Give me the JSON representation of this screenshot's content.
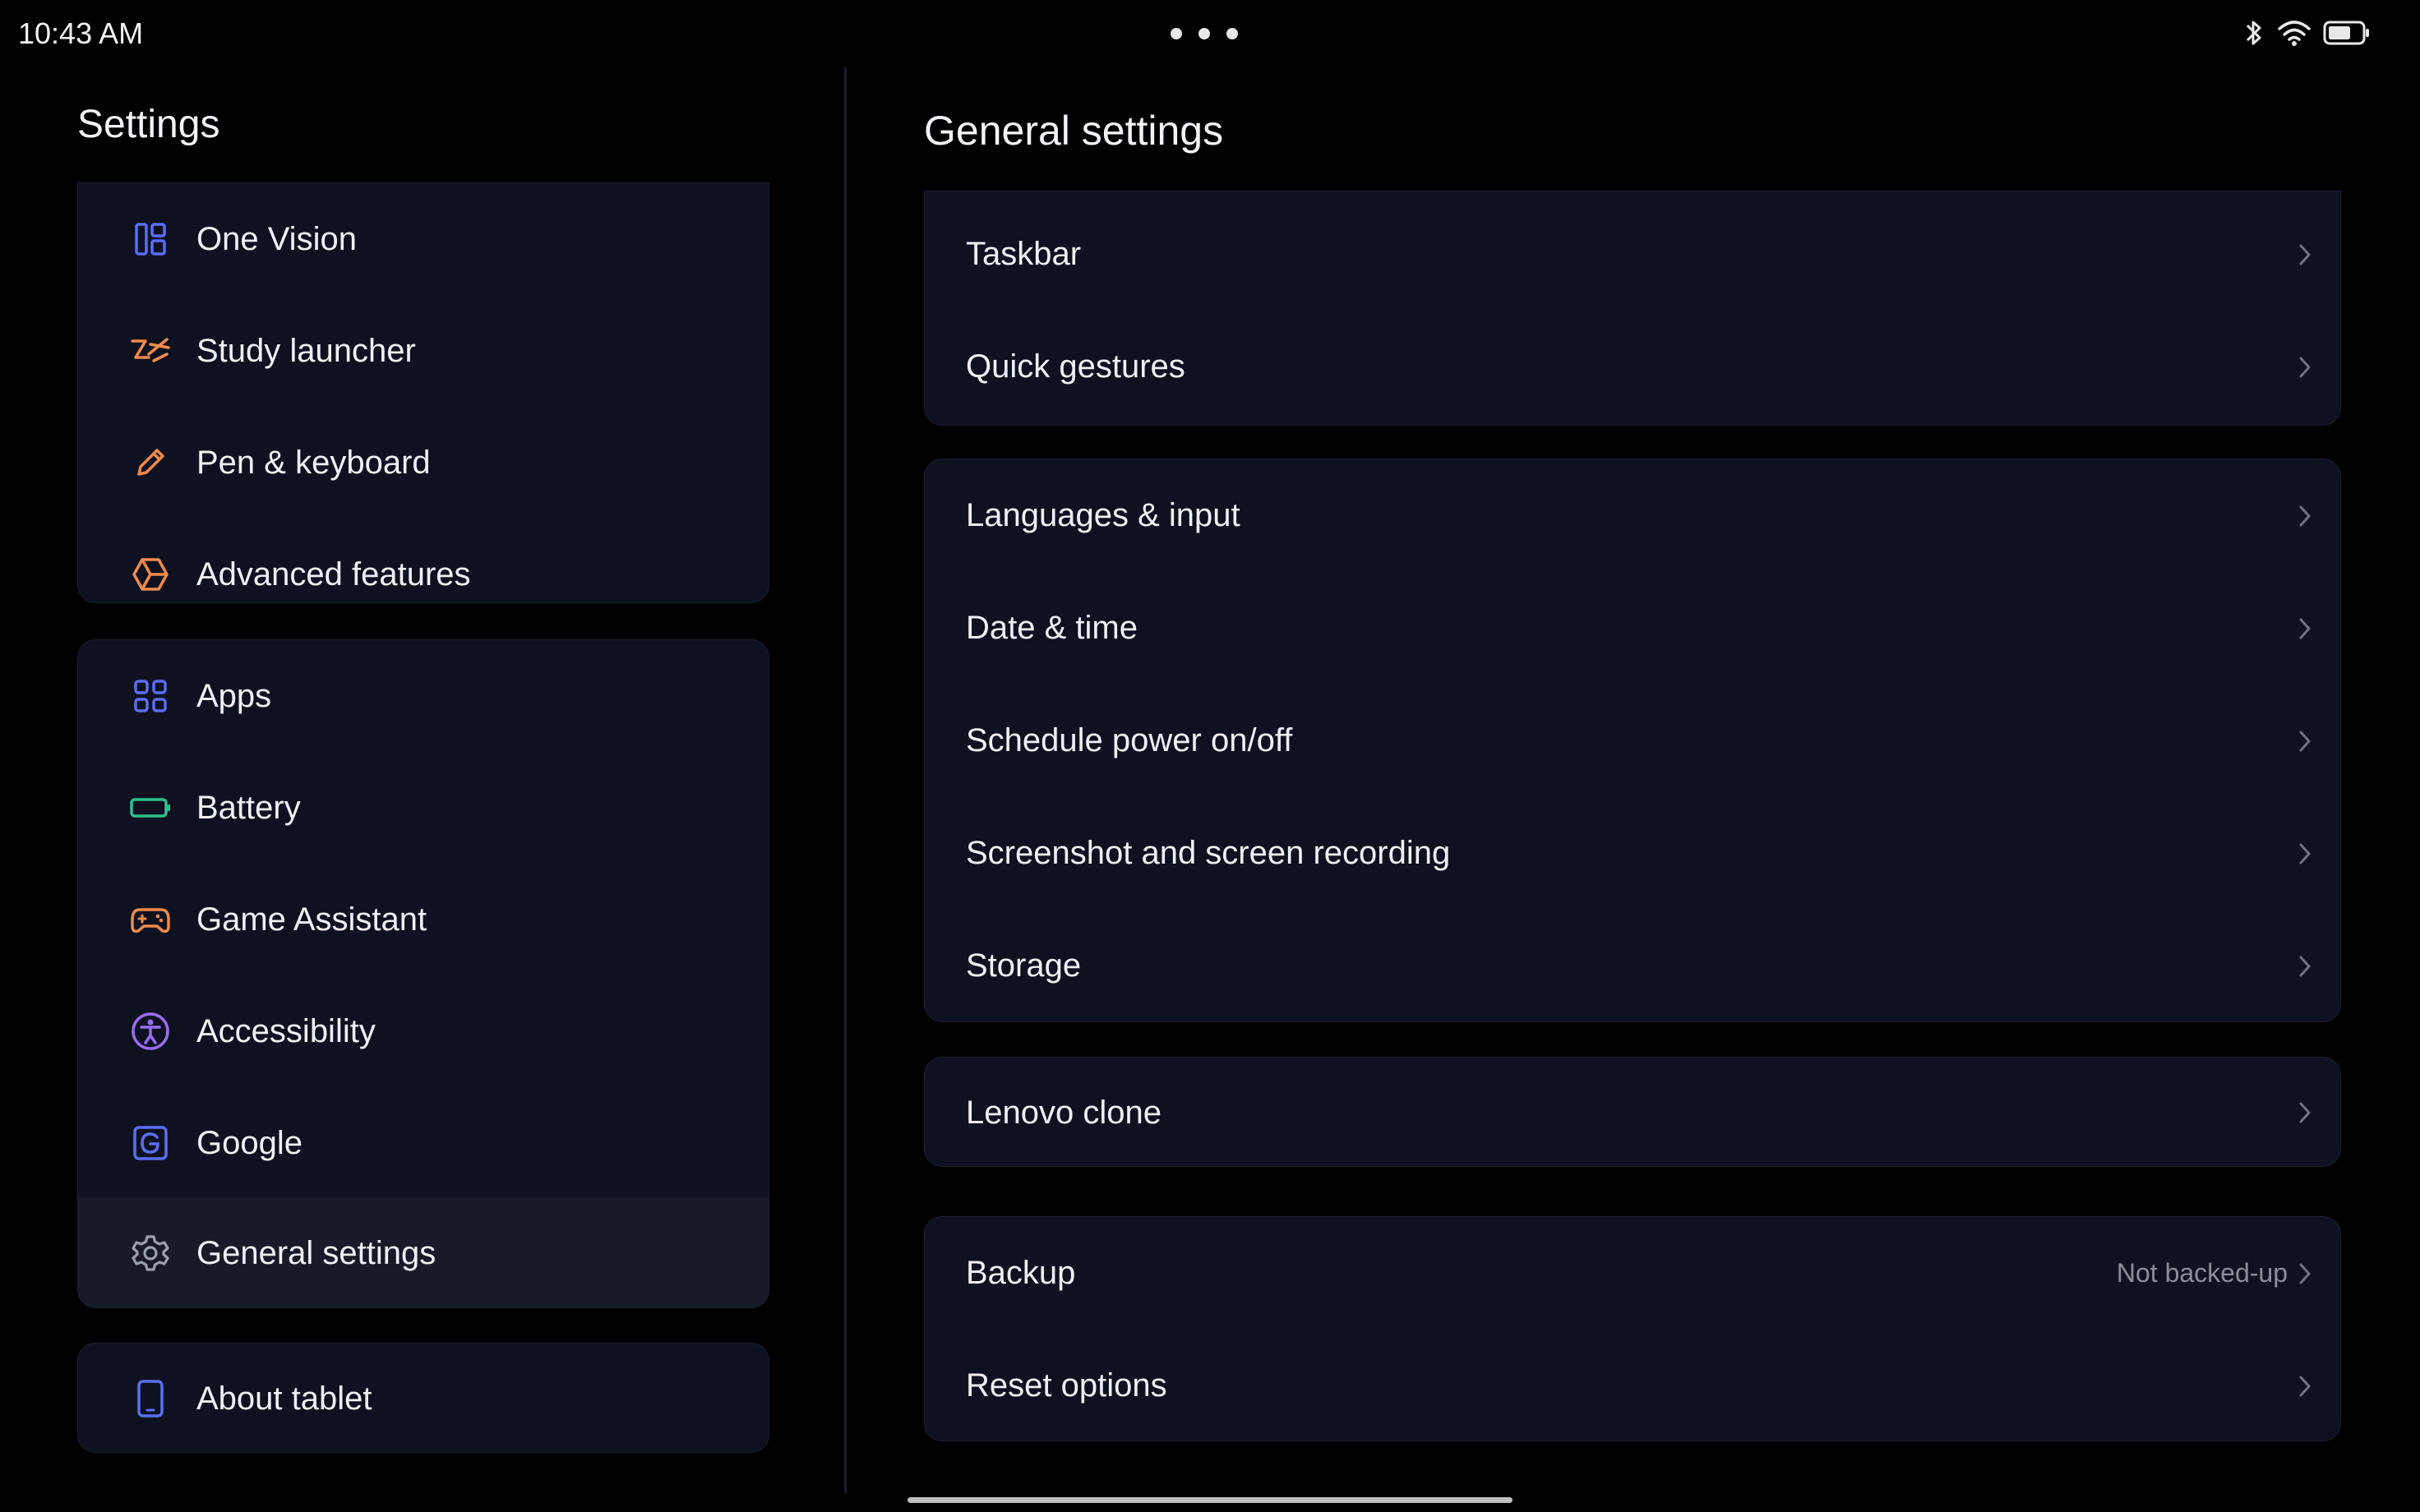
{
  "status_bar": {
    "time": "10:43 AM",
    "icons": [
      "bluetooth-icon",
      "wifi-icon",
      "battery-icon"
    ]
  },
  "colors": {
    "accent_blue": "#5b6ef5",
    "accent_orange": "#f08a4b",
    "accent_green": "#2fbf8f",
    "accent_purple": "#9a6bf2"
  },
  "sidebar": {
    "title": "Settings",
    "groups": [
      {
        "items": [
          {
            "label": "One Vision",
            "icon": "one-vision-icon"
          },
          {
            "label": "Study launcher",
            "icon": "study-launcher-icon"
          },
          {
            "label": "Pen & keyboard",
            "icon": "pen-icon"
          },
          {
            "label": "Advanced features",
            "icon": "advanced-features-icon"
          }
        ]
      },
      {
        "items": [
          {
            "label": "Apps",
            "icon": "apps-grid-icon"
          },
          {
            "label": "Battery",
            "icon": "battery-icon"
          },
          {
            "label": "Game Assistant",
            "icon": "gamepad-icon"
          },
          {
            "label": "Accessibility",
            "icon": "accessibility-icon"
          },
          {
            "label": "Google",
            "icon": "google-icon"
          },
          {
            "label": "General settings",
            "icon": "gear-icon",
            "selected": true
          }
        ]
      },
      {
        "items": [
          {
            "label": "About tablet",
            "icon": "tablet-icon"
          }
        ]
      }
    ]
  },
  "main": {
    "title": "General settings",
    "groups": [
      {
        "items": [
          {
            "label": "Taskbar"
          },
          {
            "label": "Quick gestures"
          }
        ]
      },
      {
        "items": [
          {
            "label": "Languages & input"
          },
          {
            "label": "Date & time"
          },
          {
            "label": "Schedule power on/off"
          },
          {
            "label": "Screenshot and screen recording"
          },
          {
            "label": "Storage"
          }
        ]
      },
      {
        "items": [
          {
            "label": "Lenovo clone"
          }
        ]
      },
      {
        "items": [
          {
            "label": "Backup",
            "value": "Not backed-up"
          },
          {
            "label": "Reset options"
          }
        ]
      }
    ]
  }
}
